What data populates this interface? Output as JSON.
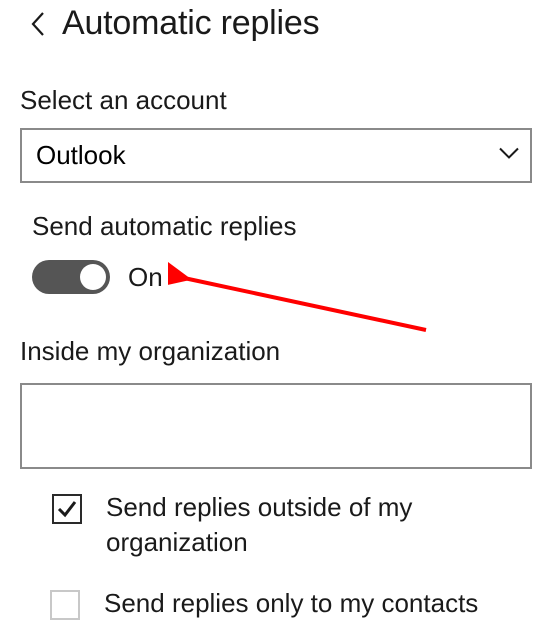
{
  "header": {
    "title": "Automatic replies"
  },
  "account": {
    "label": "Select an account",
    "selected": "Outlook"
  },
  "autoreply": {
    "label": "Send automatic replies",
    "state": "On"
  },
  "inside_org": {
    "label": "Inside my organization",
    "value": ""
  },
  "options": {
    "outside_label": "Send replies outside of my organization",
    "contacts_label": "Send replies only to my contacts"
  },
  "annotation": {
    "arrow_color": "#ff0000"
  }
}
